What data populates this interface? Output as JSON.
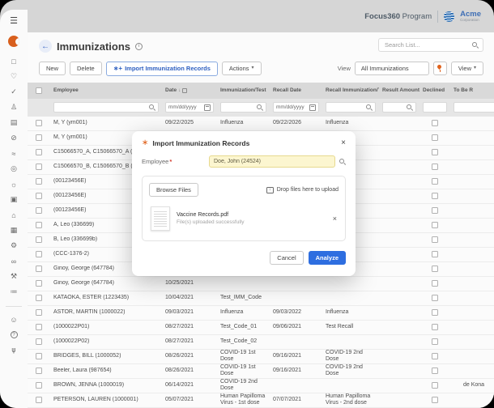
{
  "topbar": {
    "program_name": "Focus360",
    "program_suffix": " Program",
    "brand": "Acme",
    "brand_sub": "Corporation"
  },
  "icons": {
    "menu": "☰",
    "back": "←",
    "info": "i",
    "spark": "∗",
    "import_spark": "∗+",
    "caret": "▾",
    "sort_arrow": "↓",
    "close": "×",
    "drop_arrow": "↓",
    "required_mark": "*"
  },
  "sidebar": {
    "icons": [
      {
        "name": "document-icon",
        "glyph": "□"
      },
      {
        "name": "heart-badge-icon",
        "glyph": "♡"
      },
      {
        "name": "shield-check-icon",
        "glyph": "✓"
      },
      {
        "name": "user-key-icon",
        "glyph": "♙"
      },
      {
        "name": "id-card-icon",
        "glyph": "▤"
      },
      {
        "name": "slash-circle-icon",
        "glyph": "⊘"
      },
      {
        "name": "waves-icon",
        "glyph": "≈"
      },
      {
        "name": "check-circle-icon",
        "glyph": "◎"
      },
      {
        "name": "lightbulb-icon",
        "glyph": "☼"
      },
      {
        "name": "image-frame-icon",
        "glyph": "▣"
      },
      {
        "name": "graduation-cap-icon",
        "glyph": "⌂"
      },
      {
        "name": "notebook-icon",
        "glyph": "▦"
      },
      {
        "name": "gear-icon",
        "glyph": "⚙"
      },
      {
        "name": "link-icon",
        "glyph": "∞"
      },
      {
        "name": "tools-icon",
        "glyph": "⚒"
      },
      {
        "name": "list-settings-icon",
        "glyph": "≔"
      }
    ],
    "bottom_icons": [
      {
        "name": "user-circle-icon",
        "glyph": "☺"
      },
      {
        "name": "help-icon",
        "glyph": "?"
      },
      {
        "name": "org-chart-icon",
        "glyph": "⋔"
      }
    ]
  },
  "page": {
    "title": "Immunizations",
    "search_placeholder": "Search List...",
    "toolbar": {
      "new": "New",
      "delete": "Delete",
      "import": "Import Immunization Records",
      "actions": "Actions"
    },
    "viewbar": {
      "label": "View",
      "selected": "All Immunizations",
      "view_button": "View"
    }
  },
  "table": {
    "columns": [
      "Employee",
      "Date",
      "Immunization/Test",
      "Recall Date",
      "Recall Immunization/Test",
      "Result Amount",
      "Declined",
      "To Be R"
    ],
    "date_placeholder": "mm/dd/yyyy",
    "rows": [
      {
        "employee": "M, Y (ym001)",
        "date": "09/22/2025",
        "immunization": "Influenza",
        "recall_date": "09/22/2026",
        "recall_immunization": "Influenza",
        "result_amount": "",
        "to_be_recalled": ""
      },
      {
        "employee": "M, Y (ym001)",
        "date": "",
        "immunization": "",
        "recall_date": "",
        "recall_immunization": "",
        "result_amount": "",
        "to_be_recalled": ""
      },
      {
        "employee": "C15066570_A, C15066570_A (C",
        "date": "",
        "immunization": "",
        "recall_date": "",
        "recall_immunization": "",
        "result_amount": "",
        "to_be_recalled": ""
      },
      {
        "employee": "C15066570_B, C15066570_B (C",
        "date": "",
        "immunization": "",
        "recall_date": "",
        "recall_immunization": "",
        "result_amount": "",
        "to_be_recalled": ""
      },
      {
        "employee": "(00123456E)",
        "date": "",
        "immunization": "",
        "recall_date": "",
        "recall_immunization": "",
        "result_amount": "",
        "to_be_recalled": ""
      },
      {
        "employee": "(00123456E)",
        "date": "",
        "immunization": "",
        "recall_date": "",
        "recall_immunization": "",
        "result_amount": "",
        "to_be_recalled": ""
      },
      {
        "employee": "(00123456E)",
        "date": "",
        "immunization": "",
        "recall_date": "",
        "recall_immunization": "",
        "result_amount": "",
        "to_be_recalled": ""
      },
      {
        "employee": "A, Leo (336699)",
        "date": "",
        "immunization": "",
        "recall_date": "",
        "recall_immunization": "",
        "result_amount": "",
        "to_be_recalled": ""
      },
      {
        "employee": "B, Leo (336699b)",
        "date": "",
        "immunization": "",
        "recall_date": "",
        "recall_immunization": "",
        "result_amount": "",
        "to_be_recalled": ""
      },
      {
        "employee": "(CCC-1376-2)",
        "date": "",
        "immunization": "",
        "recall_date": "",
        "recall_immunization": "",
        "result_amount": "",
        "to_be_recalled": ""
      },
      {
        "employee": "Ginoy, George (647784)",
        "date": "",
        "immunization": "",
        "recall_date": "",
        "recall_immunization": "",
        "result_amount": "",
        "to_be_recalled": ""
      },
      {
        "employee": "Ginoy, George (647784)",
        "date": "10/25/2021",
        "immunization": "",
        "recall_date": "",
        "recall_immunization": "",
        "result_amount": "",
        "to_be_recalled": ""
      },
      {
        "employee": "KATAOKA, ESTER (1223435)",
        "date": "10/04/2021",
        "immunization": "Test_IMM_Code",
        "recall_date": "",
        "recall_immunization": "",
        "result_amount": "",
        "to_be_recalled": ""
      },
      {
        "employee": "ASTOR, MARTIN (1000022)",
        "date": "09/03/2021",
        "immunization": "Influenza",
        "recall_date": "09/03/2022",
        "recall_immunization": "Influenza",
        "result_amount": "",
        "to_be_recalled": ""
      },
      {
        "employee": "(1000022P01)",
        "date": "08/27/2021",
        "immunization": "Test_Code_01",
        "recall_date": "09/06/2021",
        "recall_immunization": "Test Recall",
        "result_amount": "",
        "to_be_recalled": ""
      },
      {
        "employee": "(1000022P02)",
        "date": "08/27/2021",
        "immunization": "Test_Code_02",
        "recall_date": "",
        "recall_immunization": "",
        "result_amount": "",
        "to_be_recalled": ""
      },
      {
        "employee": "BRIDGES, BILL (1000052)",
        "date": "08/26/2021",
        "immunization": "COVID-19 1st Dose",
        "recall_date": "09/16/2021",
        "recall_immunization": "COVID-19 2nd Dose",
        "result_amount": "",
        "to_be_recalled": ""
      },
      {
        "employee": "Beeler, Laura (987654)",
        "date": "08/26/2021",
        "immunization": "COVID-19 1st Dose",
        "recall_date": "09/16/2021",
        "recall_immunization": "COVID-19 2nd Dose",
        "result_amount": "",
        "to_be_recalled": ""
      },
      {
        "employee": "BROWN, JENNA (1000019)",
        "date": "06/14/2021",
        "immunization": "COVID-19 2nd Dose",
        "recall_date": "",
        "recall_immunization": "",
        "result_amount": "",
        "to_be_recalled": "de Kona"
      },
      {
        "employee": "PETERSON, LAUREN (1000001)",
        "date": "05/07/2021",
        "immunization": "Human Papilloma Virus - 1st dose",
        "recall_date": "07/07/2021",
        "recall_immunization": "Human Papilloma Virus - 2nd dose",
        "result_amount": "",
        "to_be_recalled": ""
      }
    ]
  },
  "modal": {
    "title": "Import Immunization Records",
    "employee_label": "Employee",
    "employee_value": "Doe, John (24524)",
    "browse": "Browse Files",
    "drop_text": "Drop files here to upload",
    "file": {
      "name": "Vaccine Records.pdf",
      "status": "File(s) uploaded successfully"
    },
    "cancel": "Cancel",
    "analyze": "Analyze"
  }
}
